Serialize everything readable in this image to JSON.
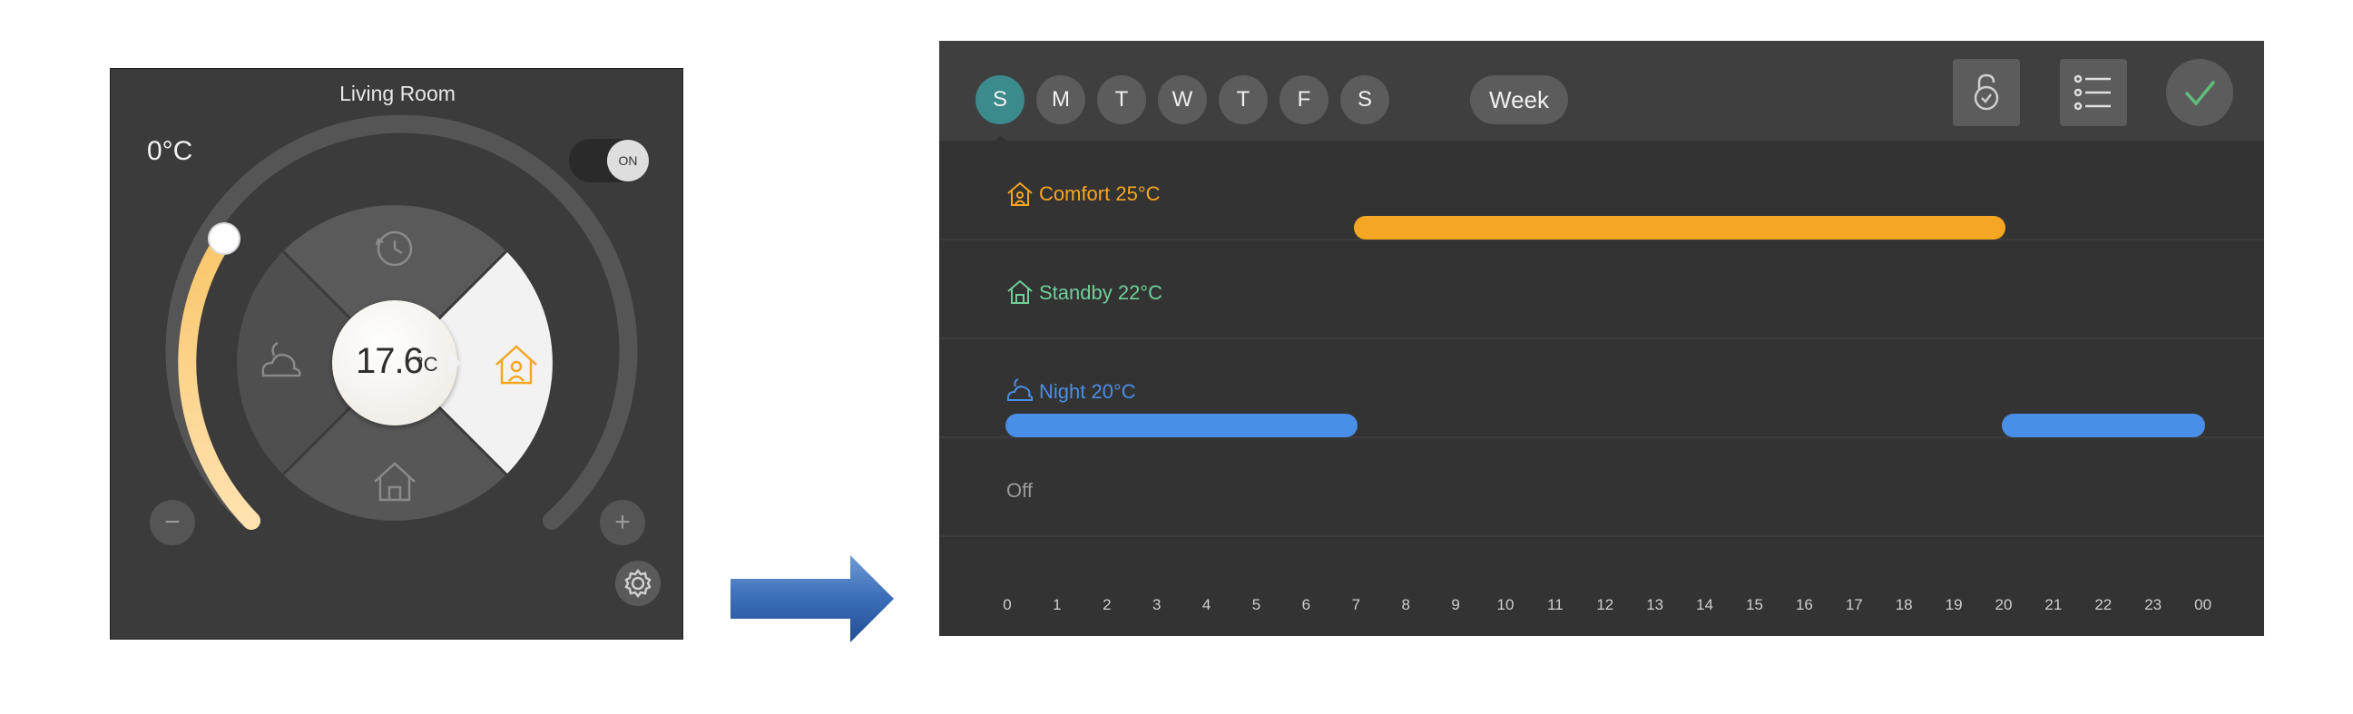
{
  "thermostat": {
    "title": "Living Room",
    "current_temp": "0°C",
    "toggle_label": "ON",
    "setpoint_value": "17.6",
    "setpoint_unit": "°C",
    "minus_label": "−",
    "plus_label": "+"
  },
  "schedule": {
    "days": [
      "S",
      "M",
      "T",
      "W",
      "T",
      "F",
      "S"
    ],
    "active_day_index": 0,
    "week_label": "Week",
    "modes": [
      {
        "name": "Comfort",
        "label": "Comfort 25°C",
        "color": "#f5a623",
        "icon": "house-person-icon"
      },
      {
        "name": "Standby",
        "label": "Standby 22°C",
        "color": "#6fcf97",
        "icon": "house-standby-icon"
      },
      {
        "name": "Night",
        "label": "Night 20°C",
        "color": "#4a8fe7",
        "icon": "moon-cloud-icon"
      },
      {
        "name": "Off",
        "label": "Off",
        "color": "#9a9a9a",
        "icon": ""
      }
    ],
    "hours": [
      "0",
      "1",
      "2",
      "3",
      "4",
      "5",
      "6",
      "7",
      "8",
      "9",
      "10",
      "11",
      "12",
      "13",
      "14",
      "15",
      "16",
      "17",
      "18",
      "19",
      "20",
      "21",
      "22",
      "23",
      "00"
    ],
    "segments": [
      {
        "mode": "Comfort",
        "start": 7,
        "end": 20
      },
      {
        "mode": "Night",
        "start": 0,
        "end": 7
      },
      {
        "mode": "Night",
        "start": 20,
        "end": 24
      }
    ]
  },
  "colors": {
    "accent_comfort": "#f5a623",
    "accent_standby": "#6fcf97",
    "accent_night": "#4a8fe7",
    "active_day": "#3b8a8c"
  }
}
